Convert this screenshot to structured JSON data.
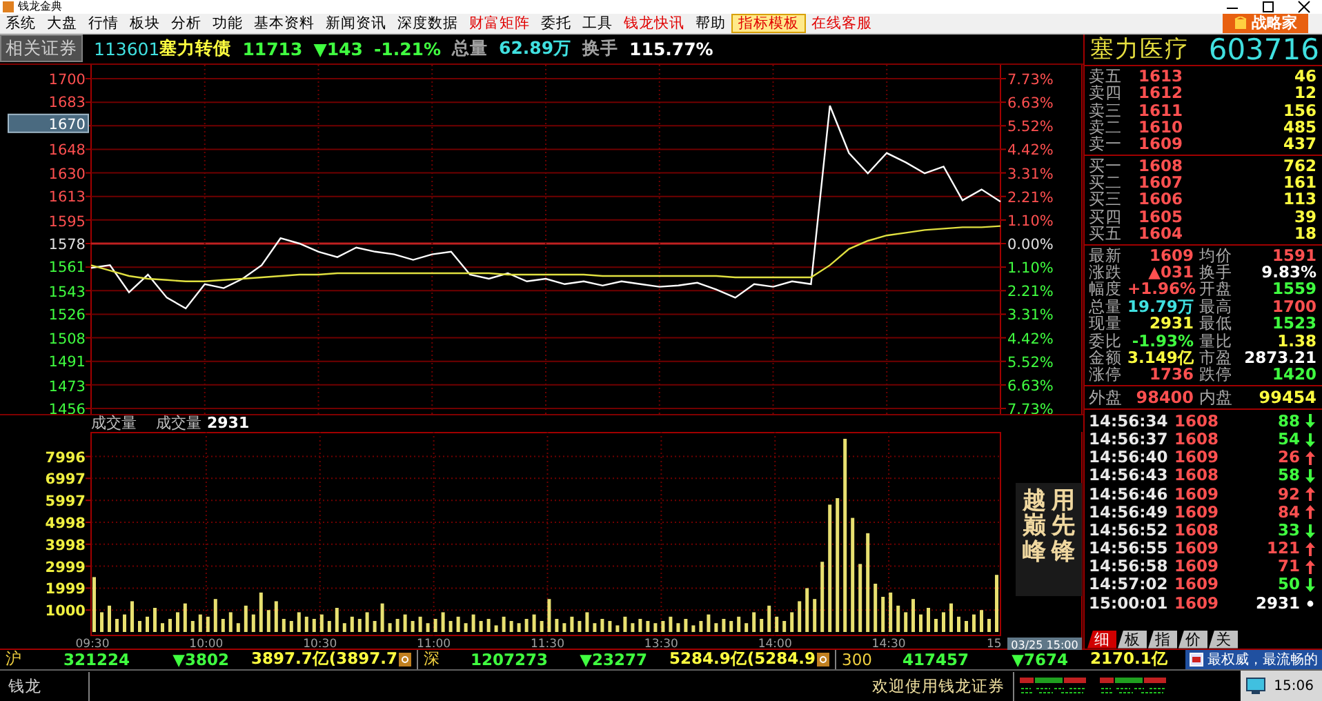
{
  "window": {
    "title": "钱龙金典"
  },
  "menu": [
    {
      "label": "系统",
      "accent": false,
      "selected": false
    },
    {
      "label": "大盘",
      "accent": false,
      "selected": false
    },
    {
      "label": "行情",
      "accent": false,
      "selected": false
    },
    {
      "label": "板块",
      "accent": false,
      "selected": false
    },
    {
      "label": "分析",
      "accent": false,
      "selected": false
    },
    {
      "label": "功能",
      "accent": false,
      "selected": false
    },
    {
      "label": "基本资料",
      "accent": false,
      "selected": false
    },
    {
      "label": "新闻资讯",
      "accent": false,
      "selected": false
    },
    {
      "label": "深度数据",
      "accent": false,
      "selected": false
    },
    {
      "label": "财富矩阵",
      "accent": true,
      "selected": false
    },
    {
      "label": "委托",
      "accent": false,
      "selected": false
    },
    {
      "label": "工具",
      "accent": false,
      "selected": false
    },
    {
      "label": "钱龙快讯",
      "accent": true,
      "selected": false
    },
    {
      "label": "帮助",
      "accent": false,
      "selected": false
    },
    {
      "label": "指标模板",
      "accent": true,
      "selected": true
    },
    {
      "label": "在线客服",
      "accent": true,
      "selected": false
    }
  ],
  "strategist_button": {
    "label": "战略家"
  },
  "quote_header": {
    "related_button": "相关证券",
    "items": [
      {
        "text": "113601",
        "color": "#40e0e0"
      },
      {
        "text": "塞力转债",
        "color": "#ffff40"
      },
      {
        "text": "11713",
        "color": "#40ff40"
      },
      {
        "text": "▼143",
        "color": "#40ff40"
      },
      {
        "text": "-1.21%",
        "color": "#40ff40"
      },
      {
        "text": "总量",
        "color": "#a0a0a0"
      },
      {
        "text": "62.89万",
        "color": "#40e0e0"
      },
      {
        "text": "换手",
        "color": "#a0a0a0"
      },
      {
        "text": "115.77%",
        "color": "#ffffff"
      }
    ]
  },
  "price_panel": {
    "cursor_label": "1670",
    "right_axis_labels": [
      {
        "text": "7.73%",
        "color": "#ff5050"
      },
      {
        "text": "6.63%",
        "color": "#ff5050"
      },
      {
        "text": "5.52%",
        "color": "#ff5050"
      },
      {
        "text": "4.42%",
        "color": "#ff5050"
      },
      {
        "text": "3.31%",
        "color": "#ff5050"
      },
      {
        "text": "2.21%",
        "color": "#ff5050"
      },
      {
        "text": "1.10%",
        "color": "#ff5050"
      },
      {
        "text": "0.00%",
        "color": "#e0e0e0"
      },
      {
        "text": "1.10%",
        "color": "#40ff40"
      },
      {
        "text": "2.21%",
        "color": "#40ff40"
      },
      {
        "text": "3.31%",
        "color": "#40ff40"
      },
      {
        "text": "4.42%",
        "color": "#40ff40"
      },
      {
        "text": "5.52%",
        "color": "#40ff40"
      },
      {
        "text": "6.63%",
        "color": "#40ff40"
      },
      {
        "text": "7.73%",
        "color": "#40ff40"
      }
    ],
    "chart_data": {
      "type": "line",
      "grid": true,
      "ref_lines": [
        {
          "axis": "y",
          "value": 1578
        }
      ],
      "categories": [
        null,
        null,
        null,
        null,
        null,
        null,
        null,
        null,
        null,
        null,
        null,
        null,
        null,
        null,
        null,
        null,
        null,
        null,
        null,
        null,
        null,
        null,
        null,
        null,
        null,
        null,
        null,
        null,
        null,
        null,
        null,
        null,
        null,
        null,
        null,
        null,
        null,
        null,
        null,
        null,
        null,
        null,
        null,
        null,
        null,
        null,
        null,
        null,
        null
      ],
      "series": [
        {
          "color": "#ffffff",
          "values": [
            1560,
            1562,
            1542,
            1555,
            1538,
            1530,
            1548,
            1545,
            1552,
            1562,
            1582,
            1578,
            1572,
            1568,
            1575,
            1572,
            1570,
            1566,
            1570,
            1572,
            1555,
            1552,
            1556,
            1550,
            1552,
            1548,
            1550,
            1547,
            1550,
            1548,
            1546,
            1547,
            1549,
            1544,
            1538,
            1548,
            1546,
            1550,
            1548,
            1680,
            1645,
            1630,
            1645,
            1638,
            1630,
            1635,
            1610,
            1618,
            1609
          ]
        },
        {
          "color": "#e0e040",
          "values": [
            1562,
            1558,
            1554,
            1552,
            1551,
            1550,
            1550,
            1551,
            1552,
            1553,
            1554,
            1555,
            1555,
            1556,
            1556,
            1556,
            1556,
            1556,
            1556,
            1556,
            1556,
            1556,
            1555,
            1555,
            1555,
            1555,
            1555,
            1554,
            1554,
            1554,
            1554,
            1554,
            1554,
            1554,
            1553,
            1553,
            1553,
            1553,
            1553,
            1562,
            1574,
            1580,
            1584,
            1586,
            1588,
            1589,
            1590,
            1590,
            1591
          ]
        }
      ],
      "ylim": [
        1456,
        1700
      ],
      "yticks": [
        {
          "value": 1700,
          "label": "1700"
        },
        {
          "value": 1683,
          "label": "1683"
        },
        {
          "value": 1648,
          "label": "1648"
        },
        {
          "value": 1630,
          "label": "1630"
        },
        {
          "value": 1613,
          "label": "1613"
        },
        {
          "value": 1595,
          "label": "1595"
        },
        {
          "value": 1578,
          "label": "1578"
        },
        {
          "value": 1561,
          "label": "1561"
        },
        {
          "value": 1543,
          "label": "1543"
        },
        {
          "value": 1526,
          "label": "1526"
        },
        {
          "value": 1508,
          "label": "1508"
        },
        {
          "value": 1491,
          "label": "1491"
        },
        {
          "value": 1473,
          "label": "1473"
        },
        {
          "value": 1456,
          "label": "1456"
        }
      ]
    }
  },
  "volume_panel": {
    "title": "成交量",
    "current_label": "成交量",
    "current_value": "2931",
    "cursor_time": "03/25 15:00",
    "chart_data": {
      "type": "bar",
      "grid": true,
      "categories": [
        "09:30",
        null,
        null,
        null,
        null,
        null,
        null,
        null,
        null,
        null,
        null,
        null,
        null,
        null,
        null,
        "10:00",
        null,
        null,
        null,
        null,
        null,
        null,
        null,
        null,
        null,
        null,
        null,
        null,
        null,
        null,
        "10:30",
        null,
        null,
        null,
        null,
        null,
        null,
        null,
        null,
        null,
        null,
        null,
        null,
        null,
        null,
        "11:00",
        null,
        null,
        null,
        null,
        null,
        null,
        null,
        null,
        null,
        null,
        null,
        null,
        null,
        null,
        "11:30",
        null,
        null,
        null,
        null,
        null,
        null,
        null,
        null,
        null,
        null,
        null,
        null,
        null,
        null,
        "13:30",
        null,
        null,
        null,
        null,
        null,
        null,
        null,
        null,
        null,
        null,
        null,
        null,
        null,
        null,
        "14:00",
        null,
        null,
        null,
        null,
        null,
        null,
        null,
        null,
        null,
        null,
        null,
        null,
        null,
        null,
        "14:30",
        null,
        null,
        null,
        null,
        null,
        null,
        null,
        null,
        null,
        null,
        null,
        null,
        null,
        "15"
      ],
      "series": [
        {
          "color": "#e8e070",
          "values": [
            2500,
            900,
            1200,
            600,
            800,
            1400,
            500,
            700,
            1100,
            400,
            600,
            900,
            1300,
            500,
            800,
            700,
            1500,
            600,
            900,
            400,
            1200,
            800,
            1800,
            1000,
            1400,
            600,
            500,
            900,
            700,
            600,
            800,
            500,
            1100,
            400,
            700,
            600,
            900,
            500,
            1300,
            400,
            600,
            800,
            500,
            700,
            400,
            600,
            900,
            500,
            700,
            400,
            800,
            500,
            600,
            300,
            700,
            500,
            400,
            600,
            800,
            500,
            1500,
            600,
            400,
            700,
            500,
            900,
            400,
            600,
            500,
            300,
            700,
            400,
            600,
            500,
            400,
            500,
            700,
            400,
            600,
            300,
            500,
            800,
            400,
            600,
            500,
            700,
            400,
            900,
            600,
            1200,
            700,
            500,
            900,
            1400,
            2000,
            1500,
            3200,
            5800,
            6100,
            8800,
            5200,
            3100,
            4500,
            2200,
            1600,
            1800,
            1200,
            900,
            1500,
            800,
            1100,
            600,
            900,
            1300,
            700,
            500,
            800,
            1000,
            600,
            2600
          ]
        }
      ],
      "ylim": [
        0,
        8800
      ],
      "yticks": [
        {
          "value": 7996,
          "label": "7996"
        },
        {
          "value": 6997,
          "label": "6997"
        },
        {
          "value": 5997,
          "label": "5997"
        },
        {
          "value": 4998,
          "label": "4998"
        },
        {
          "value": 3998,
          "label": "3998"
        },
        {
          "value": 2999,
          "label": "2999"
        },
        {
          "value": 1999,
          "label": "1999"
        },
        {
          "value": 1000,
          "label": "1000"
        }
      ]
    }
  },
  "ad_banner": [
    "越巅峰",
    "用先锋"
  ],
  "stock": {
    "name": "塞力医疗",
    "code": "603716"
  },
  "order_book": {
    "asks": [
      {
        "label": "卖五",
        "price": "1613",
        "volume": "46"
      },
      {
        "label": "卖四",
        "price": "1612",
        "volume": "12"
      },
      {
        "label": "卖三",
        "price": "1611",
        "volume": "156"
      },
      {
        "label": "卖二",
        "price": "1610",
        "volume": "485"
      },
      {
        "label": "卖一",
        "price": "1609",
        "volume": "437"
      }
    ],
    "bids": [
      {
        "label": "买一",
        "price": "1608",
        "volume": "762"
      },
      {
        "label": "买二",
        "price": "1607",
        "volume": "161"
      },
      {
        "label": "买三",
        "price": "1606",
        "volume": "113"
      },
      {
        "label": "买四",
        "price": "1605",
        "volume": "39"
      },
      {
        "label": "买五",
        "price": "1604",
        "volume": "18"
      }
    ]
  },
  "quote_stats": [
    {
      "label": "最新",
      "value": "1609",
      "color": "#ff5050"
    },
    {
      "label": "均价",
      "value": "1591",
      "color": "#ff5050"
    },
    {
      "label": "涨跌",
      "value": "▲031",
      "color": "#ff5050"
    },
    {
      "label": "换手",
      "value": "9.83%",
      "color": "#ffffff"
    },
    {
      "label": "幅度",
      "value": "+1.96%",
      "color": "#ff5050"
    },
    {
      "label": "开盘",
      "value": "1559",
      "color": "#40ff40"
    },
    {
      "label": "总量",
      "value": "19.79万",
      "color": "#40e0e0"
    },
    {
      "label": "最高",
      "value": "1700",
      "color": "#ff5050"
    },
    {
      "label": "现量",
      "value": "2931",
      "color": "#ffff40"
    },
    {
      "label": "最低",
      "value": "1523",
      "color": "#40ff40"
    },
    {
      "label": "委比",
      "value": "-1.93%",
      "color": "#40ff40"
    },
    {
      "label": "量比",
      "value": "1.38",
      "color": "#ffff40"
    },
    {
      "label": "金额",
      "value": "3.149亿",
      "color": "#ffff40"
    },
    {
      "label": "市盈",
      "value": "2873.21",
      "color": "#ffffff"
    },
    {
      "label": "涨停",
      "value": "1736",
      "color": "#ff5050"
    },
    {
      "label": "跌停",
      "value": "1420",
      "color": "#40ff40"
    }
  ],
  "outer_inner": [
    {
      "label": "外盘",
      "value": "98400",
      "color": "#ff5050"
    },
    {
      "label": "内盘",
      "value": "99454",
      "color": "#ffff40"
    }
  ],
  "trades": [
    {
      "time": "14:56:34",
      "price": "1608",
      "volume": "88",
      "kind": "down"
    },
    {
      "time": "14:56:37",
      "price": "1608",
      "volume": "54",
      "kind": "down"
    },
    {
      "time": "14:56:40",
      "price": "1609",
      "volume": "26",
      "kind": "up"
    },
    {
      "time": "14:56:43",
      "price": "1608",
      "volume": "58",
      "kind": "down"
    },
    {
      "time": "14:56:46",
      "price": "1609",
      "volume": "92",
      "kind": "up"
    },
    {
      "time": "14:56:49",
      "price": "1609",
      "volume": "84",
      "kind": "up"
    },
    {
      "time": "14:56:52",
      "price": "1608",
      "volume": "33",
      "kind": "down"
    },
    {
      "time": "14:56:55",
      "price": "1609",
      "volume": "121",
      "kind": "up"
    },
    {
      "time": "14:56:58",
      "price": "1609",
      "volume": "71",
      "kind": "up"
    },
    {
      "time": "14:57:02",
      "price": "1609",
      "volume": "50",
      "kind": "down"
    },
    {
      "time": "15:00:01",
      "price": "1609",
      "volume": "2931",
      "kind": "neutral"
    }
  ],
  "detail_tabs": [
    {
      "label": "细",
      "selected": true
    },
    {
      "label": "板",
      "selected": false
    },
    {
      "label": "指",
      "selected": false
    },
    {
      "label": "价",
      "selected": false
    },
    {
      "label": "关",
      "selected": false
    }
  ],
  "index_ticker": [
    {
      "market": "沪",
      "value": "321224",
      "change": "▼3802",
      "amount": "3897.7亿(3897.7",
      "info": true
    },
    {
      "market": "深",
      "value": "1207273",
      "change": "▼23277",
      "amount": "5284.9亿(5284.9",
      "info": true
    },
    {
      "market": "300",
      "value": "417457",
      "change": "▼7674",
      "amount": "2170.1亿",
      "info": false
    }
  ],
  "news_ticker": "最权威，最流畅的",
  "status_bar": {
    "label": "钱龙",
    "message": "欢迎使用钱龙证券",
    "clock": "15:06"
  }
}
